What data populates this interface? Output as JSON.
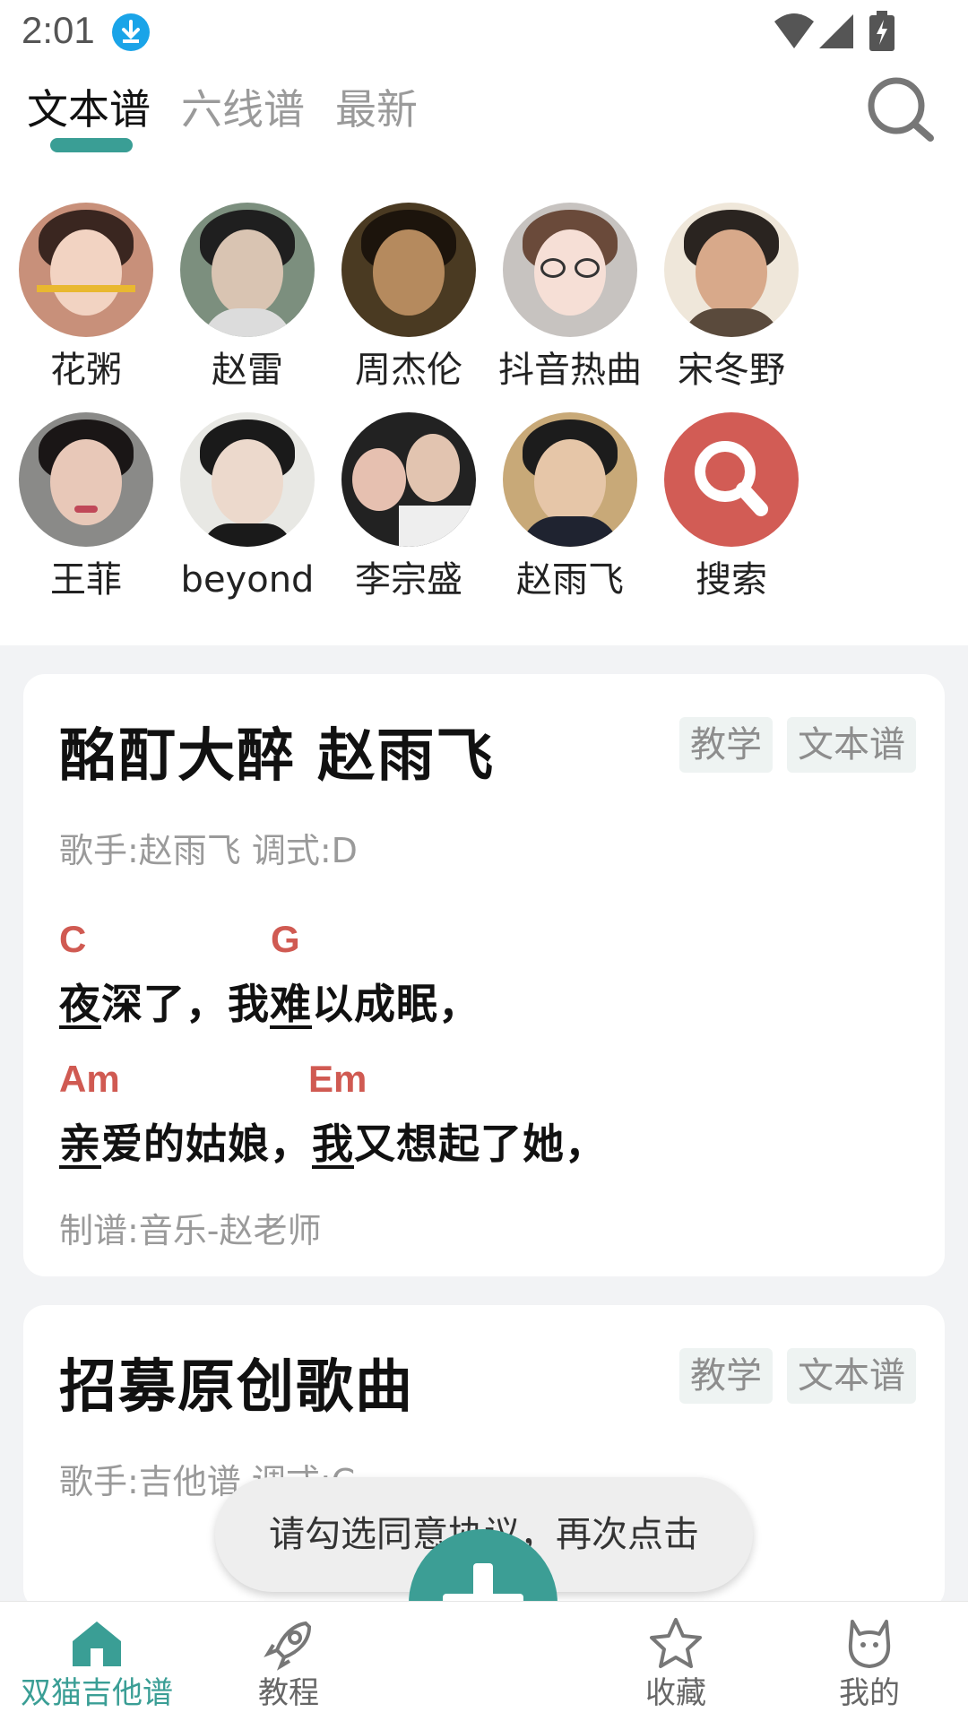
{
  "status_bar": {
    "time": "2:01"
  },
  "tabs": [
    {
      "label": "文本谱",
      "active": true
    },
    {
      "label": "六线谱",
      "active": false
    },
    {
      "label": "最新",
      "active": false
    }
  ],
  "artists": [
    {
      "name": "花粥"
    },
    {
      "name": "赵雷"
    },
    {
      "name": "周杰伦"
    },
    {
      "name": "抖音热曲"
    },
    {
      "name": "宋冬野"
    },
    {
      "name": "王菲"
    },
    {
      "name": "beyond"
    },
    {
      "name": "李宗盛"
    },
    {
      "name": "赵雨飞"
    },
    {
      "name": "搜索"
    }
  ],
  "cards": [
    {
      "title": "酩酊大醉 赵雨飞",
      "tags": [
        "教学",
        "文本谱"
      ],
      "meta": "歌手:赵雨飞  调式:D",
      "lines": [
        {
          "chords": [
            "C",
            "G"
          ],
          "lyric_parts": [
            "夜",
            "深了，我",
            "难",
            "以成眠，"
          ]
        },
        {
          "chords": [
            "Am",
            "Em"
          ],
          "lyric_parts": [
            "亲",
            "爱的姑娘，",
            "我",
            "又想起了她，"
          ]
        }
      ],
      "author": "制谱:音乐-赵老师"
    },
    {
      "title": "招募原创歌曲",
      "tags": [
        "教学",
        "文本谱"
      ],
      "meta": "歌手:吉他谱  调式:C"
    }
  ],
  "toast": "请勾选同意协议，再次点击",
  "bottom_nav": [
    {
      "label": "双猫吉他谱",
      "icon": "home-icon",
      "active": true
    },
    {
      "label": "教程",
      "icon": "rocket-icon",
      "active": false
    },
    {
      "label": "收藏",
      "icon": "star-icon",
      "active": false
    },
    {
      "label": "我的",
      "icon": "cat-icon",
      "active": false
    }
  ],
  "colors": {
    "accent": "#3a9e95",
    "chord": "#d05a52",
    "search_bubble": "#d25c55"
  }
}
